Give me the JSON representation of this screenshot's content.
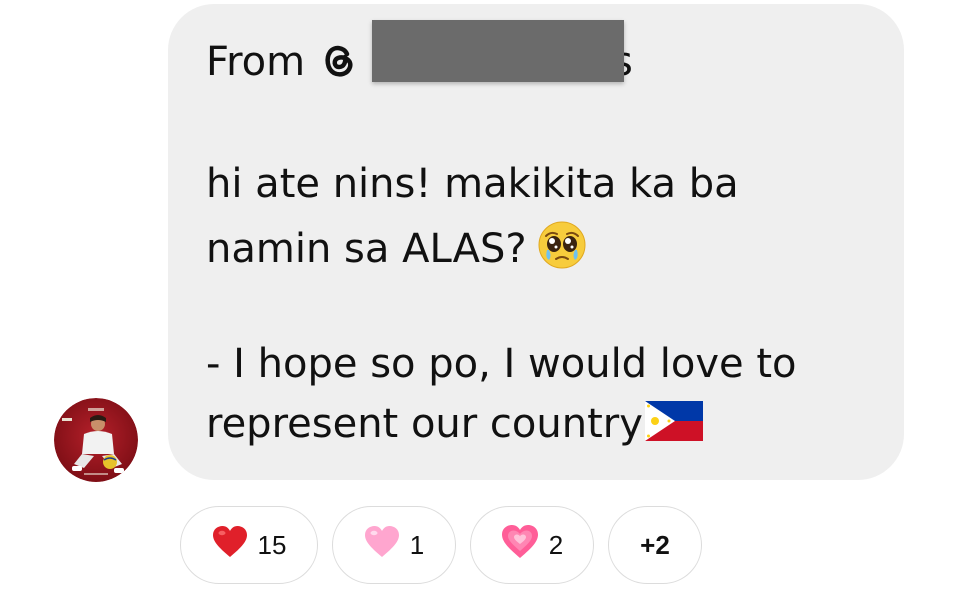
{
  "message": {
    "from_label": "From",
    "username_tail": "s",
    "line1": "hi ate nins! makikita ka ba",
    "line2": "namin sa ALAS?",
    "line3": "- I hope so po, I would love to",
    "line4": "represent our country"
  },
  "icons": {
    "threads": "threads-logo-icon",
    "pleading": "pleading-face-emoji",
    "flag": "philippines-flag-emoji",
    "avatar": "profile-avatar"
  },
  "reactions": [
    {
      "emoji": "red-heart",
      "count": "15"
    },
    {
      "emoji": "pink-heart",
      "count": "1"
    },
    {
      "emoji": "growing-heart",
      "count": "2"
    }
  ],
  "more_reactions": "+2"
}
